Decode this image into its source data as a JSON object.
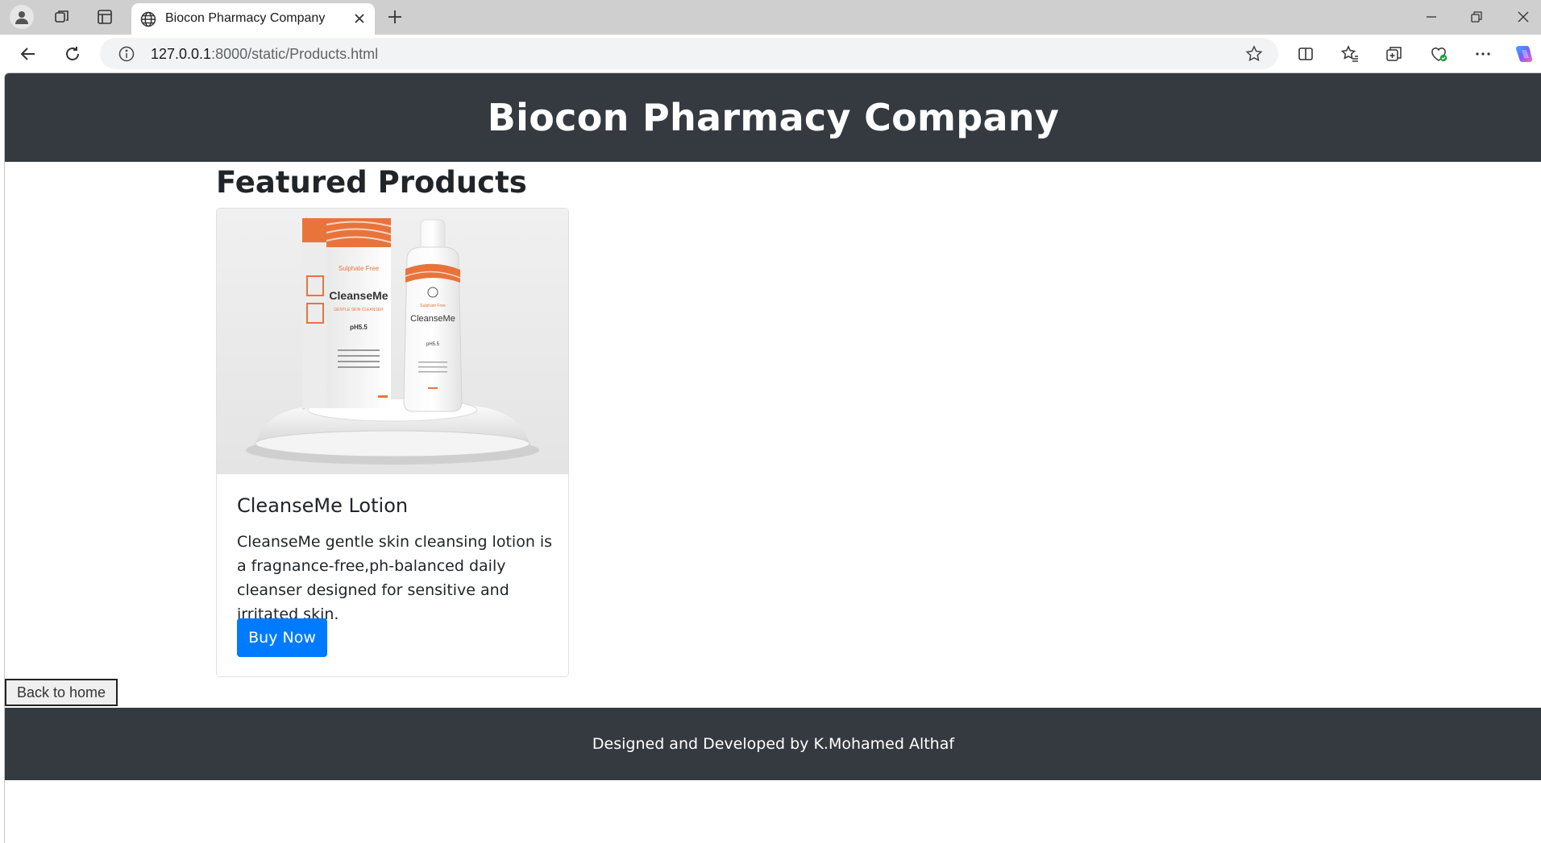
{
  "browser": {
    "tab_title": "Biocon Pharmacy Company",
    "url_host": "127.0.0.1",
    "url_path": ":8000/static/Products.html",
    "icons": [
      "profile-icon",
      "workspaces-icon",
      "tab-actions-icon",
      "globe-icon",
      "close-icon",
      "new-tab-icon",
      "minimize-icon",
      "restore-icon",
      "window-close-icon",
      "back-icon",
      "refresh-icon",
      "site-info-icon",
      "favorite-star-icon",
      "split-screen-icon",
      "favorites-icon",
      "collections-icon",
      "browser-essentials-icon",
      "more-icon",
      "copilot-icon"
    ]
  },
  "header": {
    "title": "Biocon Pharmacy Company"
  },
  "main": {
    "section_title": "Featured Products",
    "products": [
      {
        "image_alt": "CleanseMe product box and bottle",
        "image_text": {
          "brand": "CleanseMe",
          "tag": "Sulphate Free",
          "subtitle": "GENTLE SKIN CLEANSER",
          "ph": "pH5.5"
        },
        "title": "CleanseMe Lotion",
        "description": "CleanseMe gentle skin cleansing lotion is a fragnance-free,ph-balanced daily cleanser designed for sensitive and irritated skin.",
        "button_label": "Buy Now"
      }
    ]
  },
  "back_button_label": "Back to home",
  "footer": {
    "text": "Designed and Developed by K.Mohamed Althaf"
  },
  "colors": {
    "header_bg": "#343a40",
    "primary": "#007bff",
    "brand_orange": "#e8743b"
  }
}
